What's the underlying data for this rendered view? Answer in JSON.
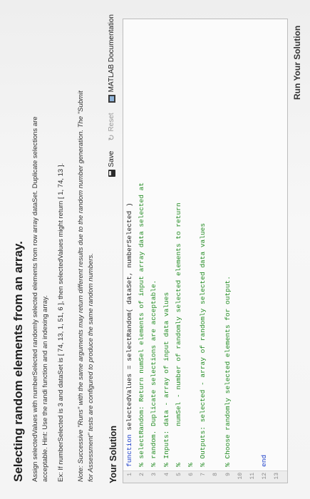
{
  "problem": {
    "title": "Selecting random elements from an array.",
    "description": [
      "Assign selectedValues with numberSelected randomly selected elements from row array dataSet. Duplicate selections are",
      "acceptable. Hint: Use the randi function and an indexing array.",
      "Ex: If numberSelected is 3 and dataSet is [ 74, 13, 1, 51, 6 ], then selectedValues might return [ 1, 74, 13 ]."
    ],
    "note": [
      "Note: Successive \"Runs\" with the same arguments may return different results due to the random number generation. The \"Submit",
      "for Assessment\" tests are configured to produce the same random numbers."
    ]
  },
  "solution": {
    "heading": "Your Solution",
    "save_label": "Save",
    "reset_label": "Reset",
    "docs_label": "MATLAB Documentation",
    "code": [
      {
        "n": "1",
        "kw": "function",
        "rest": " selectedValues = selectRandom( dataSet, numberSelected )"
      },
      {
        "n": "2",
        "cm": "% selectRandom: Return numSel elements of input array data selected at"
      },
      {
        "n": "3",
        "cm": "% random. Duplicate selections are acceptable."
      },
      {
        "n": "4",
        "cm": "% Inputs: data - array of input data values"
      },
      {
        "n": "5",
        "cm": "%         numSel - number of randomly selected elements to return"
      },
      {
        "n": "6",
        "cm": "%"
      },
      {
        "n": "7",
        "cm": "% Outputs: selected - array of randomly selected data values"
      },
      {
        "n": "8",
        "rest": ""
      },
      {
        "n": "9",
        "cm": "% Choose randomly selected elements for output."
      },
      {
        "n": "10",
        "rest": ""
      },
      {
        "n": "11",
        "rest": ""
      },
      {
        "n": "12",
        "kw": "end",
        "rest": ""
      },
      {
        "n": "13",
        "rest": ""
      }
    ],
    "run_label": "Run Your Solution"
  }
}
